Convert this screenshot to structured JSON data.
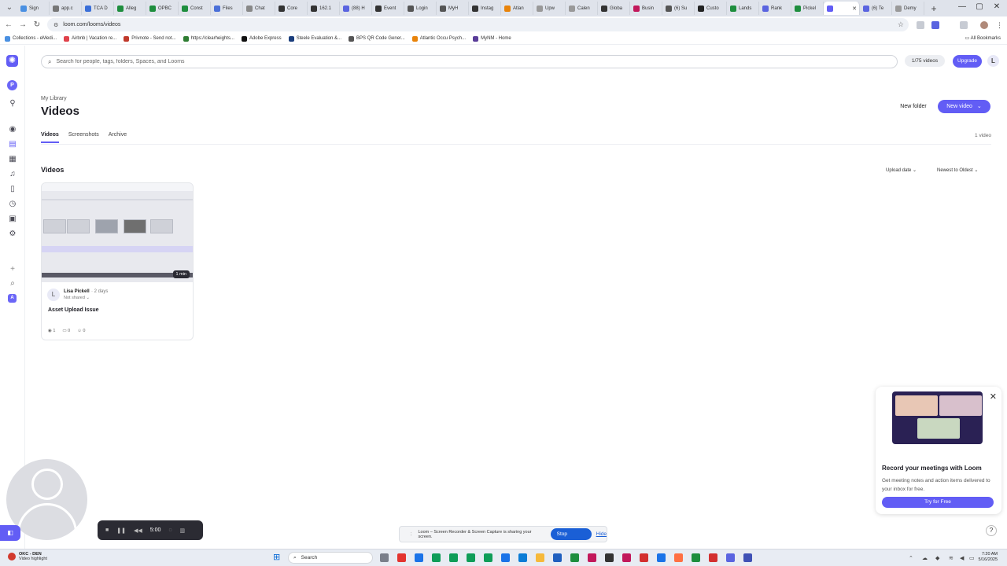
{
  "browser": {
    "tabs": [
      {
        "label": "Sign",
        "color": "#4a90e2"
      },
      {
        "label": "app.c",
        "color": "#777777"
      },
      {
        "label": "TCA D",
        "color": "#3b6fd8"
      },
      {
        "label": "Alleg",
        "color": "#1e8e3e"
      },
      {
        "label": "OPBC",
        "color": "#1e8e3e"
      },
      {
        "label": "Const",
        "color": "#1e8e3e"
      },
      {
        "label": "Files",
        "color": "#4a6fd8"
      },
      {
        "label": "Chat",
        "color": "#888888"
      },
      {
        "label": "Core",
        "color": "#333333"
      },
      {
        "label": "162.1",
        "color": "#333333"
      },
      {
        "label": "(88) H",
        "color": "#5a64e0"
      },
      {
        "label": "Event",
        "color": "#333333"
      },
      {
        "label": "Login",
        "color": "#555555"
      },
      {
        "label": "MyH",
        "color": "#555555"
      },
      {
        "label": "Instag",
        "color": "#333333"
      },
      {
        "label": "Atlan",
        "color": "#e8830a"
      },
      {
        "label": "Upw",
        "color": "#999999"
      },
      {
        "label": "Calen",
        "color": "#999999"
      },
      {
        "label": "Globa",
        "color": "#333333"
      },
      {
        "label": "Busin",
        "color": "#c2185b"
      },
      {
        "label": "(6) Su",
        "color": "#555555"
      },
      {
        "label": "Custo",
        "color": "#222222"
      },
      {
        "label": "Lands",
        "color": "#1e8e3e"
      },
      {
        "label": "Rank",
        "color": "#5a64e0"
      },
      {
        "label": "Pickel",
        "color": "#1e8e3e"
      },
      {
        "label": "",
        "color": "#625df5",
        "active": true
      },
      {
        "label": "(6) Te",
        "color": "#5a64e0"
      },
      {
        "label": "Demy",
        "color": "#999999"
      }
    ],
    "url": "loom.com/looms/videos",
    "bookmarks": [
      {
        "label": "Collections - eMedi...",
        "color": "#4a90e2"
      },
      {
        "label": "Airbnb | Vacation re...",
        "color": "#e0424b"
      },
      {
        "label": "Privnote - Send not...",
        "color": "#c0392b"
      },
      {
        "label": "https://clearheights...",
        "color": "#2e7d32"
      },
      {
        "label": "Adobe Express",
        "color": "#111111"
      },
      {
        "label": "Steele Evaluation &...",
        "color": "#1a3d7c"
      },
      {
        "label": "BPS QR Code Gener...",
        "color": "#555555"
      },
      {
        "label": "Atlantic Occu Psych...",
        "color": "#e8830a"
      },
      {
        "label": "MyNM - Home",
        "color": "#5a3d99"
      }
    ],
    "all_bookmarks": "All Bookmarks"
  },
  "app": {
    "search_placeholder": "Search for people, tags, folders, Spaces, and Looms",
    "video_count_pill": "1/75 videos",
    "upgrade_label": "Upgrade",
    "user_initial": "L",
    "workspace_initial": "P",
    "secondary_workspace_initial": "A",
    "breadcrumb": "My Library",
    "page_title": "Videos",
    "new_folder_label": "New folder",
    "new_video_label": "New video",
    "tabs": [
      "Videos",
      "Screenshots",
      "Archive"
    ],
    "total_videos": "1 video",
    "section_title": "Videos",
    "sort_field": "Upload date",
    "sort_order": "Newest to Oldest",
    "accent": "#625df5"
  },
  "video_card": {
    "duration": "1 min",
    "author_initial": "L",
    "author": "Lisa Pickell",
    "time_ago": "· 2 days",
    "share_status": "Not shared ⌄",
    "title": "Asset Upload Issue",
    "views": "1",
    "comments": "0",
    "reactions": "0"
  },
  "promo": {
    "title": "Record your meetings with Loom",
    "description": "Get meeting notes and action items delivered to your inbox for free.",
    "button": "Try for Free"
  },
  "recorder": {
    "timer": "5:00"
  },
  "share_banner": {
    "message": "Loom – Screen Recorder & Screen Capture is sharing your screen.",
    "stop_label": "Stop sharing",
    "hide_label": "Hide"
  },
  "taskbar": {
    "weather_title": "OKC - DEN",
    "weather_sub": "Video highlight",
    "search_label": "Search",
    "time": "7:20 AM",
    "date": "5/16/2025"
  }
}
